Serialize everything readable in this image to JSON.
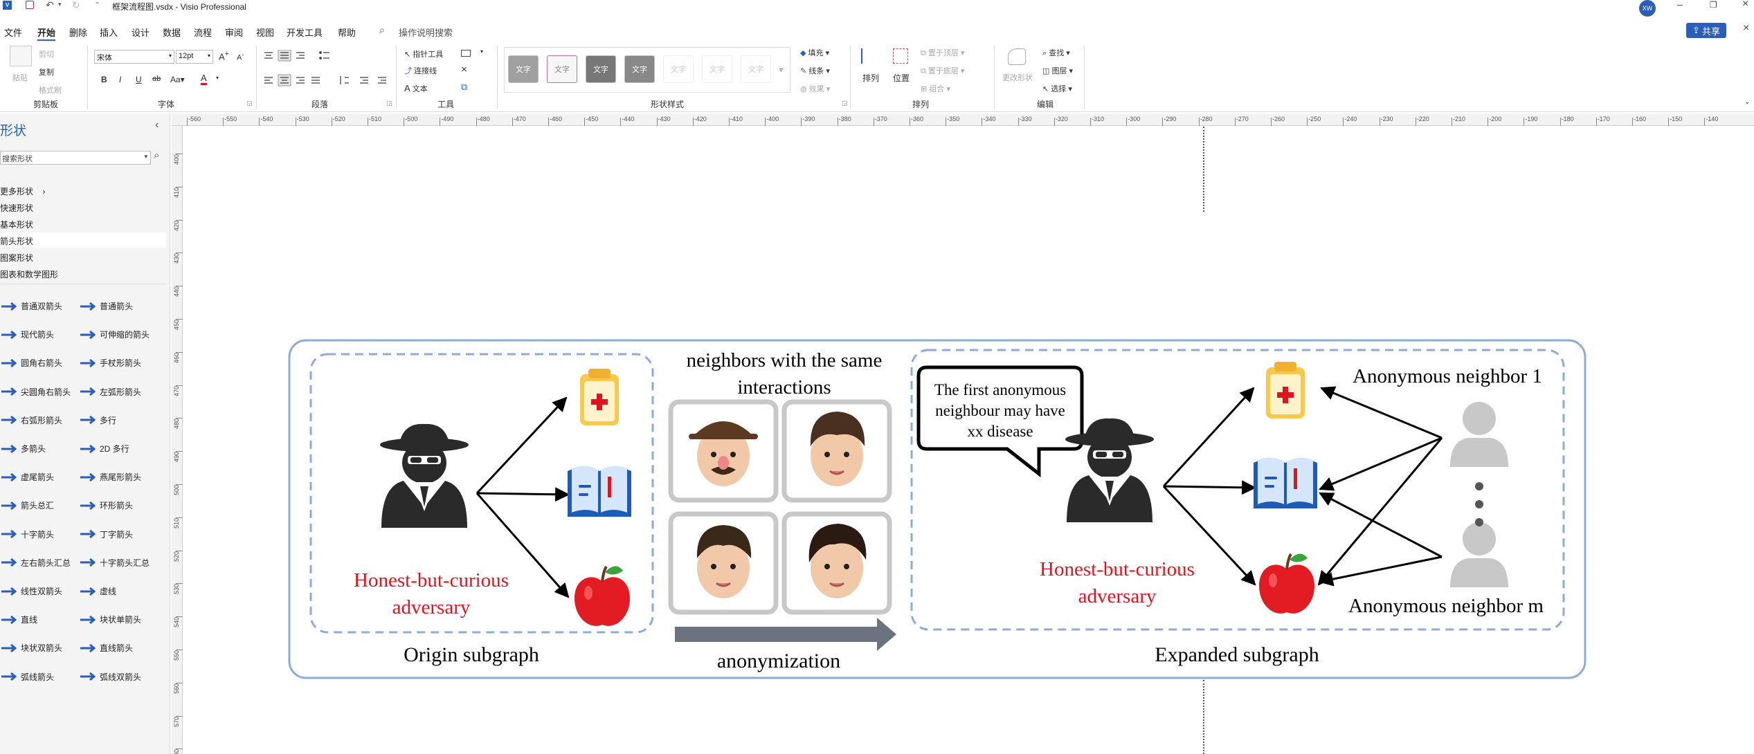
{
  "window": {
    "title": "框架流程图.vsdx  -  Visio Professional",
    "avatar": "XW",
    "share": "共享"
  },
  "menu": [
    "文件",
    "开始",
    "删除",
    "插入",
    "设计",
    "数据",
    "流程",
    "审阅",
    "视图",
    "开发工具",
    "帮助"
  ],
  "search_hint": "操作说明搜索",
  "ribbon": {
    "clipboard": {
      "label": "剪贴板",
      "paste": "粘贴",
      "cut": "剪切",
      "copy": "复制",
      "format_painter": "格式刷"
    },
    "font": {
      "label": "字体",
      "family": "宋体",
      "size": "12pt"
    },
    "paragraph": {
      "label": "段落"
    },
    "tools": {
      "label": "工具",
      "pointer": "指针工具",
      "connector": "连接线",
      "text": "文本"
    },
    "shape_styles": {
      "label": "形状样式",
      "swatch": "文字",
      "fill": "填充",
      "line": "线条",
      "effect": "效果"
    },
    "arrange": {
      "label": "排列",
      "arrange": "排列",
      "position": "位置",
      "bring_front": "置于顶层",
      "send_back": "置于底层",
      "group": "组合"
    },
    "edit": {
      "label": "编辑",
      "change_shape": "更改形状",
      "find": "查找",
      "layers": "图层",
      "select": "选择"
    }
  },
  "panel": {
    "title": "形状",
    "search_placeholder": "搜索形状",
    "more": "更多形状",
    "categories": [
      "快速形状",
      "基本形状",
      "箭头形状",
      "图案形状",
      "图表和数学图形"
    ],
    "shapes": [
      [
        "普通双箭头",
        "普通箭头"
      ],
      [
        "现代箭头",
        "可伸缩的箭头"
      ],
      [
        "圆角右箭头",
        "手杖形箭头"
      ],
      [
        "尖圆角右箭头",
        "左弧形箭头"
      ],
      [
        "右弧形箭头",
        "多行"
      ],
      [
        "多箭头",
        "2D 多行"
      ],
      [
        "虚尾箭头",
        "燕尾形箭头"
      ],
      [
        "箭头总汇",
        "环形箭头"
      ],
      [
        "十字箭头",
        "丁字箭头"
      ],
      [
        "左右箭头汇总",
        "十字箭头汇总"
      ],
      [
        "线性双箭头",
        "虚线"
      ],
      [
        "直线",
        "块状单箭头"
      ],
      [
        "块状双箭头",
        "直线箭头"
      ],
      [
        "弧线箭头",
        "弧线双箭头"
      ]
    ]
  },
  "hruler": [
    "-560",
    "-550",
    "-540",
    "-530",
    "-520",
    "-510",
    "-500",
    "-490",
    "-480",
    "-470",
    "-460",
    "-450",
    "-440",
    "-430",
    "-420",
    "-410",
    "-400",
    "-390",
    "-380",
    "-370",
    "-360",
    "-350",
    "-340",
    "-330",
    "-320",
    "-310",
    "-300",
    "-290",
    "-280",
    "-270",
    "-260",
    "-250",
    "-240",
    "-230",
    "-220",
    "-210",
    "-200",
    "-190",
    "-180",
    "-170",
    "-160",
    "-150",
    "-140"
  ],
  "vruler": [
    "400",
    "410",
    "420",
    "430",
    "440",
    "450",
    "460",
    "470",
    "480",
    "490",
    "500",
    "510",
    "520",
    "530",
    "540",
    "550",
    "560",
    "570",
    "580"
  ],
  "diagram": {
    "neighbors_title_1": "neighbors with the same",
    "neighbors_title_2": "interactions",
    "adversary_1": "Honest-but-curious",
    "adversary_2": "adversary",
    "origin_label": "Origin subgraph",
    "anonymization_label": "anonymization",
    "expanded_label": "Expanded subgraph",
    "bubble_1": "The first anonymous",
    "bubble_2": "neighbour may have",
    "bubble_3": "xx disease",
    "neighbor_1": "Anonymous neighbor 1",
    "neighbor_m": "Anonymous neighbor m",
    "colors": {
      "adversary_text": "#e0141e",
      "frame": "#8eabd6",
      "dash": "#8eabd6",
      "arrow_block": "#6b7280"
    }
  }
}
